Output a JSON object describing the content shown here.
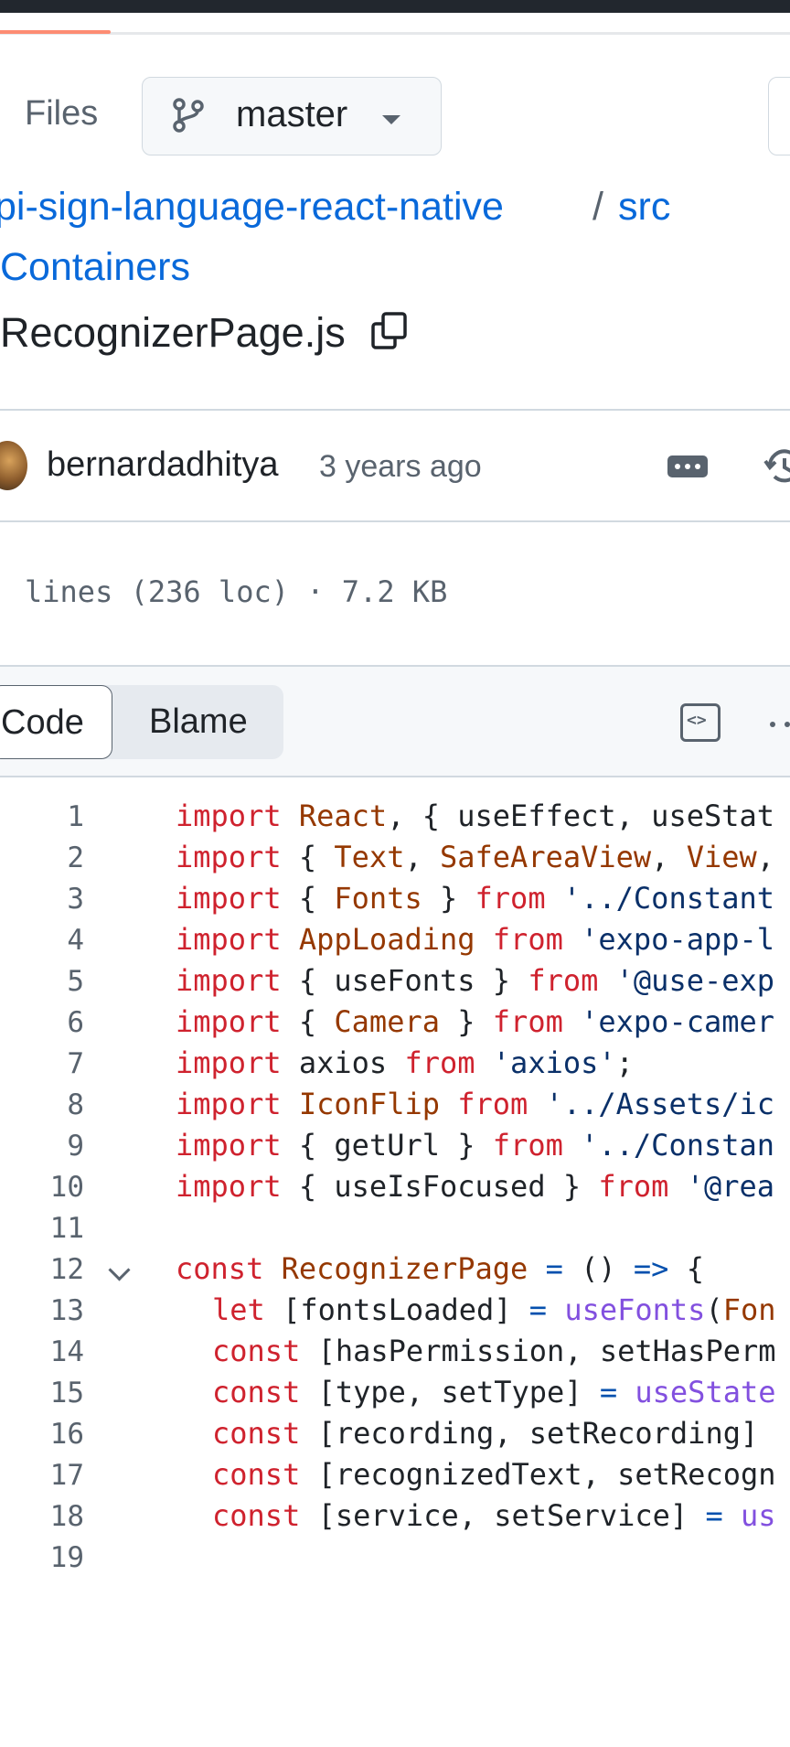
{
  "header": {
    "files_label": "Files",
    "branch": "master"
  },
  "breadcrumb": {
    "repo": "pi-sign-language-react-native",
    "separator": "/",
    "src": "src",
    "folder": "Containers",
    "file_name": "RecognizerPage.js"
  },
  "commit": {
    "author": "bernardadhitya",
    "time": "3 years ago"
  },
  "file_info": "lines (236 loc) · 7.2 KB",
  "view_tabs": {
    "code": "Code",
    "blame": "Blame"
  },
  "colors": {
    "keyword": "#cf222e",
    "identifier": "#953800",
    "string": "#0a3069",
    "function": "#8250df",
    "operator": "#0550ae",
    "plain": "#1f2328",
    "link": "#0969da",
    "progress": "#fd8c73"
  },
  "icons": {
    "branch": "git-branch-icon",
    "caret": "caret-down-icon",
    "copy": "copy-icon",
    "more": "kebab-horizontal-icon",
    "history": "history-icon",
    "raw": "code-raw-icon",
    "fold": "chevron-down-icon"
  },
  "page_load_progress": 0.14,
  "code_lines": [
    {
      "n": "1",
      "indent": 0,
      "tokens": [
        {
          "t": "import",
          "c": "kw"
        },
        {
          "t": " ",
          "c": "pl"
        },
        {
          "t": "React",
          "c": "id"
        },
        {
          "t": ", { useEffect, useStat",
          "c": "pl"
        }
      ]
    },
    {
      "n": "2",
      "indent": 0,
      "tokens": [
        {
          "t": "import",
          "c": "kw"
        },
        {
          "t": " { ",
          "c": "pl"
        },
        {
          "t": "Text",
          "c": "id"
        },
        {
          "t": ", ",
          "c": "pl"
        },
        {
          "t": "SafeAreaView",
          "c": "id"
        },
        {
          "t": ", ",
          "c": "pl"
        },
        {
          "t": "View",
          "c": "id"
        },
        {
          "t": ",",
          "c": "pl"
        }
      ]
    },
    {
      "n": "3",
      "indent": 0,
      "tokens": [
        {
          "t": "import",
          "c": "kw"
        },
        {
          "t": " { ",
          "c": "pl"
        },
        {
          "t": "Fonts",
          "c": "id"
        },
        {
          "t": " } ",
          "c": "pl"
        },
        {
          "t": "from",
          "c": "kw"
        },
        {
          "t": " '../Constant",
          "c": "str"
        }
      ]
    },
    {
      "n": "4",
      "indent": 0,
      "tokens": [
        {
          "t": "import",
          "c": "kw"
        },
        {
          "t": " ",
          "c": "pl"
        },
        {
          "t": "AppLoading",
          "c": "id"
        },
        {
          "t": " ",
          "c": "pl"
        },
        {
          "t": "from",
          "c": "kw"
        },
        {
          "t": " 'expo-app-l",
          "c": "str"
        }
      ]
    },
    {
      "n": "5",
      "indent": 0,
      "tokens": [
        {
          "t": "import",
          "c": "kw"
        },
        {
          "t": " { useFonts } ",
          "c": "pl"
        },
        {
          "t": "from",
          "c": "kw"
        },
        {
          "t": " '@use-exp",
          "c": "str"
        }
      ]
    },
    {
      "n": "6",
      "indent": 0,
      "tokens": [
        {
          "t": "import",
          "c": "kw"
        },
        {
          "t": " { ",
          "c": "pl"
        },
        {
          "t": "Camera",
          "c": "id"
        },
        {
          "t": " } ",
          "c": "pl"
        },
        {
          "t": "from",
          "c": "kw"
        },
        {
          "t": " 'expo-camer",
          "c": "str"
        }
      ]
    },
    {
      "n": "7",
      "indent": 0,
      "tokens": [
        {
          "t": "import",
          "c": "kw"
        },
        {
          "t": " axios ",
          "c": "pl"
        },
        {
          "t": "from",
          "c": "kw"
        },
        {
          "t": " 'axios'",
          "c": "str"
        },
        {
          "t": ";",
          "c": "pl"
        }
      ]
    },
    {
      "n": "8",
      "indent": 0,
      "tokens": [
        {
          "t": "import",
          "c": "kw"
        },
        {
          "t": " ",
          "c": "pl"
        },
        {
          "t": "IconFlip",
          "c": "id"
        },
        {
          "t": " ",
          "c": "pl"
        },
        {
          "t": "from",
          "c": "kw"
        },
        {
          "t": " '../Assets/ic",
          "c": "str"
        }
      ]
    },
    {
      "n": "9",
      "indent": 0,
      "tokens": [
        {
          "t": "import",
          "c": "kw"
        },
        {
          "t": " { getUrl } ",
          "c": "pl"
        },
        {
          "t": "from",
          "c": "kw"
        },
        {
          "t": " '../Constan",
          "c": "str"
        }
      ]
    },
    {
      "n": "10",
      "indent": 0,
      "tokens": [
        {
          "t": "import",
          "c": "kw"
        },
        {
          "t": " { useIsFocused } ",
          "c": "pl"
        },
        {
          "t": "from",
          "c": "kw"
        },
        {
          "t": " '@rea",
          "c": "str"
        }
      ]
    },
    {
      "n": "11",
      "indent": 0,
      "tokens": []
    },
    {
      "n": "12",
      "indent": 0,
      "fold": true,
      "tokens": [
        {
          "t": "const",
          "c": "kw"
        },
        {
          "t": " ",
          "c": "pl"
        },
        {
          "t": "RecognizerPage",
          "c": "id"
        },
        {
          "t": " ",
          "c": "pl"
        },
        {
          "t": "=",
          "c": "op"
        },
        {
          "t": " () ",
          "c": "pl"
        },
        {
          "t": "=>",
          "c": "op"
        },
        {
          "t": " {",
          "c": "pl"
        }
      ]
    },
    {
      "n": "13",
      "indent": 1,
      "tokens": [
        {
          "t": "let",
          "c": "kw"
        },
        {
          "t": " [fontsLoaded] ",
          "c": "pl"
        },
        {
          "t": "=",
          "c": "op"
        },
        {
          "t": " ",
          "c": "pl"
        },
        {
          "t": "useFonts",
          "c": "fn"
        },
        {
          "t": "(",
          "c": "pl"
        },
        {
          "t": "Fon",
          "c": "id"
        }
      ]
    },
    {
      "n": "14",
      "indent": 1,
      "tokens": [
        {
          "t": "const",
          "c": "kw"
        },
        {
          "t": " [hasPermission, setHasPerm",
          "c": "pl"
        }
      ]
    },
    {
      "n": "15",
      "indent": 1,
      "tokens": [
        {
          "t": "const",
          "c": "kw"
        },
        {
          "t": " [type, setType] ",
          "c": "pl"
        },
        {
          "t": "=",
          "c": "op"
        },
        {
          "t": " ",
          "c": "pl"
        },
        {
          "t": "useState",
          "c": "fn"
        }
      ]
    },
    {
      "n": "16",
      "indent": 1,
      "tokens": [
        {
          "t": "const",
          "c": "kw"
        },
        {
          "t": " [recording, setRecording]",
          "c": "pl"
        }
      ]
    },
    {
      "n": "17",
      "indent": 1,
      "tokens": [
        {
          "t": "const",
          "c": "kw"
        },
        {
          "t": " [recognizedText, setRecogn",
          "c": "pl"
        }
      ]
    },
    {
      "n": "18",
      "indent": 1,
      "tokens": [
        {
          "t": "const",
          "c": "kw"
        },
        {
          "t": " [service, setService] ",
          "c": "pl"
        },
        {
          "t": "=",
          "c": "op"
        },
        {
          "t": " ",
          "c": "pl"
        },
        {
          "t": "us",
          "c": "fn"
        }
      ]
    },
    {
      "n": "19",
      "indent": 0,
      "tokens": []
    }
  ]
}
